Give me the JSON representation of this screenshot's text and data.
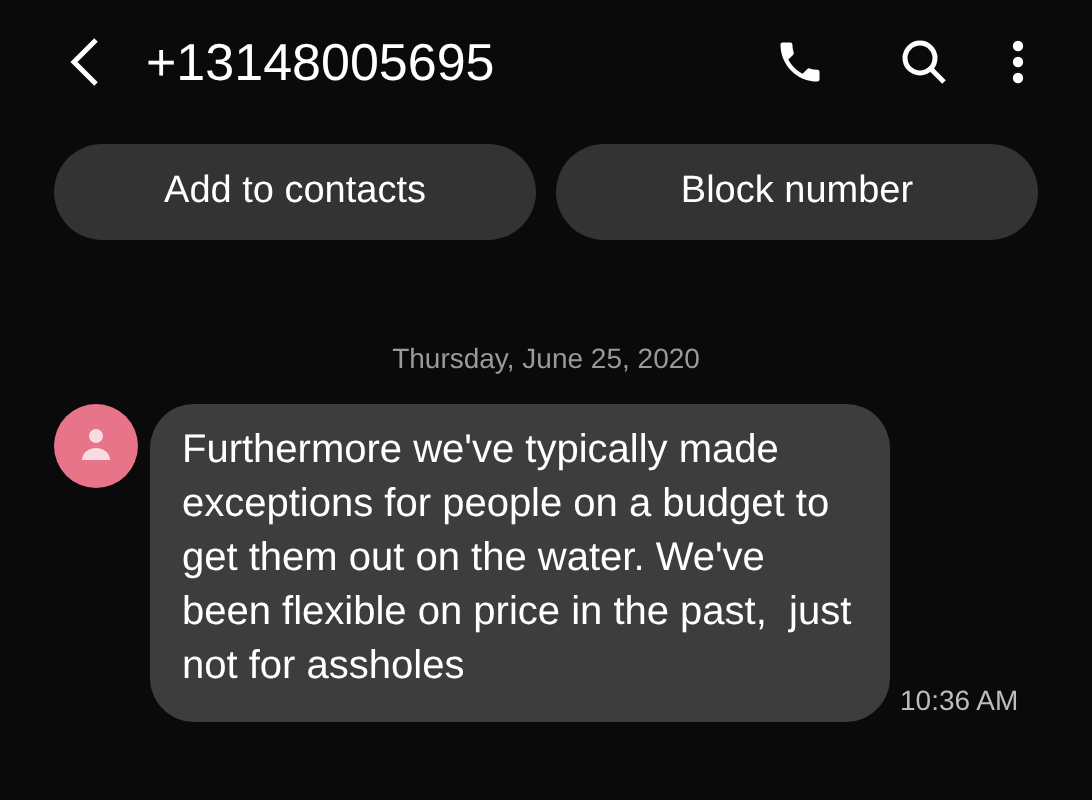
{
  "header": {
    "title": "+13148005695"
  },
  "actions": [
    "Add to contacts",
    "Block number"
  ],
  "date": "Thursday, June 25, 2020",
  "messages": [
    {
      "text": "Furthermore we've typically made exceptions for people on a budget to get them out on the water. We've been flexible on price in the past,  just not for assholes",
      "time": "10:36 AM"
    }
  ]
}
